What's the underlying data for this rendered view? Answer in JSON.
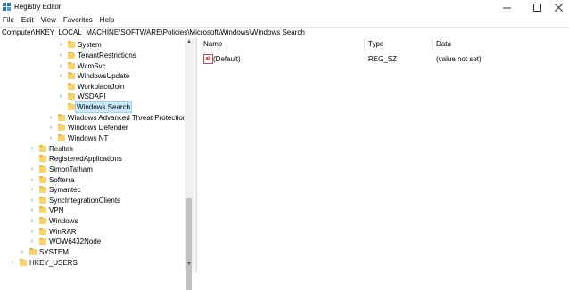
{
  "window": {
    "title": "Registry Editor",
    "minimize_icon": "minimize-icon",
    "maximize_icon": "maximize-icon",
    "close_icon": "close-icon"
  },
  "menu": [
    "File",
    "Edit",
    "View",
    "Favorites",
    "Help"
  ],
  "address": "Computer\\HKEY_LOCAL_MACHINE\\SOFTWARE\\Policies\\Microsoft\\Windows\\Windows Search",
  "tree": [
    {
      "label": "System",
      "chevron": true
    },
    {
      "label": "TenantRestrictions",
      "chevron": true
    },
    {
      "label": "WcmSvc",
      "chevron": true
    },
    {
      "label": "WindowsUpdate",
      "chevron": true
    },
    {
      "label": "WorkplaceJoin",
      "chevron": false
    },
    {
      "label": "WSDAPI",
      "chevron": true
    },
    {
      "label": "Windows Search",
      "chevron": false,
      "selected": true
    },
    {
      "label": "Windows Advanced Threat Protection",
      "chevron": true
    },
    {
      "label": "Windows Defender",
      "chevron": true
    },
    {
      "label": "Windows NT",
      "chevron": true
    },
    {
      "label": "Realtek",
      "chevron": true
    },
    {
      "label": "RegisteredApplications",
      "chevron": false
    },
    {
      "label": "SimonTatham",
      "chevron": true
    },
    {
      "label": "Softerra",
      "chevron": true
    },
    {
      "label": "Symantec",
      "chevron": true
    },
    {
      "label": "SyncIntegrationClients",
      "chevron": true
    },
    {
      "label": "VPN",
      "chevron": true
    },
    {
      "label": "Windows",
      "chevron": true
    },
    {
      "label": "WinRAR",
      "chevron": true
    },
    {
      "label": "WOW6432Node",
      "chevron": true
    },
    {
      "label": "SYSTEM",
      "chevron": true
    },
    {
      "label": "HKEY_USERS",
      "chevron": true
    }
  ],
  "columns": [
    "Name",
    "Type",
    "Data"
  ],
  "values": [
    {
      "name": "(Default)",
      "type": "REG_SZ",
      "data": "(value not set)",
      "icon": "ab"
    }
  ],
  "colors": {
    "selection": "#cce8ff",
    "folder": "#f7d36b",
    "accent": "#0078d7"
  }
}
